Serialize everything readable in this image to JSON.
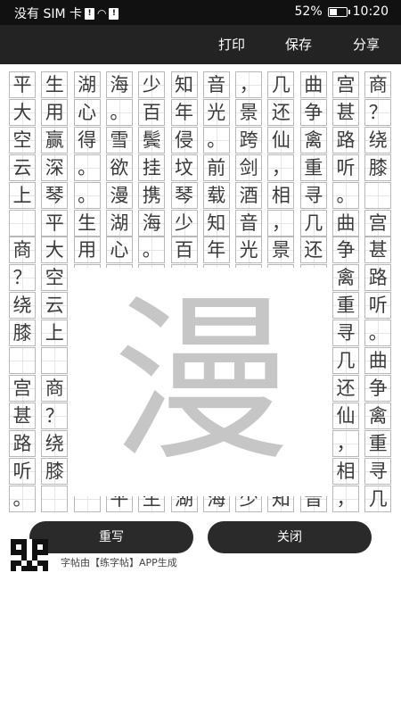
{
  "status_bar": {
    "carrier": "没有 SIM 卡",
    "icons": [
      "sim-alert-icon",
      "wifi-icon",
      "notification-icon"
    ],
    "battery_percent": "52%",
    "battery_level": 0.52,
    "time": "10:20"
  },
  "toolbar": {
    "print": "打印",
    "save": "保存",
    "share": "分享"
  },
  "grid_rows": [
    [
      "平",
      "生",
      "湖",
      "海",
      "少",
      "知",
      "音",
      "，",
      "几",
      "曲",
      "宫",
      "商"
    ],
    [
      "大",
      "用",
      "心",
      "。",
      "百",
      "年",
      "光",
      "景",
      "还",
      "争",
      "甚",
      "？"
    ],
    [
      "空",
      "赢",
      "得",
      "雪",
      "鬓",
      "侵",
      "。",
      "跨",
      "仙",
      "禽",
      "路",
      "绕"
    ],
    [
      "云",
      "深",
      "。",
      "欲",
      "挂",
      "坟",
      "前",
      "剑",
      "，",
      "重",
      "听",
      "膝"
    ],
    [
      "上",
      "琴",
      "。",
      "漫",
      "携",
      "琴",
      "载",
      "酒",
      "相",
      "寻",
      "。",
      ""
    ],
    [
      "",
      "平",
      "生",
      "湖",
      "海",
      "少",
      "知",
      "音",
      "，",
      "几",
      "曲",
      "宫"
    ],
    [
      "商",
      "大",
      "用",
      "心",
      "。",
      "百",
      "年",
      "光",
      "景",
      "还",
      "争",
      "甚"
    ],
    [
      "？",
      "空",
      "赢",
      "得",
      "雪",
      "鬓",
      "侵",
      "。",
      "跨",
      "仙",
      "禽",
      "路"
    ],
    [
      "绕",
      "云",
      "深",
      "。",
      "欲",
      "挂",
      "坟",
      "前",
      "剑",
      "，",
      "重",
      "听"
    ],
    [
      "膝",
      "上",
      "琴",
      "。",
      "漫",
      "携",
      "琴",
      "载",
      "酒",
      "相",
      "寻",
      "。"
    ],
    [
      "",
      "",
      "平",
      "生",
      "湖",
      "海",
      "少",
      "知",
      "音",
      "，",
      "几",
      "曲"
    ],
    [
      "宫",
      "商",
      "大",
      "用",
      "心",
      "。",
      "百",
      "年",
      "光",
      "景",
      "还",
      "争"
    ],
    [
      "甚",
      "？",
      "空",
      "赢",
      "得",
      "雪",
      "鬓",
      "侵",
      "。",
      "跨",
      "仙",
      "禽"
    ],
    [
      "路",
      "绕",
      "云",
      "深",
      "。",
      "欲",
      "挂",
      "坟",
      "前",
      "剑",
      "，",
      "重"
    ],
    [
      "听",
      "膝",
      "上",
      "琴",
      "。",
      "漫",
      "携",
      "琴",
      "载",
      "酒",
      "相",
      "寻"
    ],
    [
      "。",
      "",
      "",
      "平",
      "生",
      "湖",
      "海",
      "少",
      "知",
      "音",
      "，",
      "几"
    ]
  ],
  "preview": {
    "character": "漫"
  },
  "actions": {
    "rewrite": "重写",
    "close": "关闭"
  },
  "footer": {
    "note": "字帖由【练字帖】APP生成"
  }
}
